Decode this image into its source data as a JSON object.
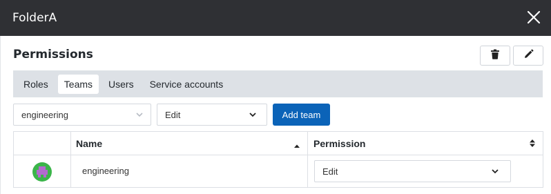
{
  "drawer": {
    "title": "FolderA",
    "close_icon": "close-icon"
  },
  "permissions": {
    "heading": "Permissions",
    "delete_icon": "trash-icon",
    "edit_icon": "pencil-icon"
  },
  "tabs": [
    {
      "label": "Roles",
      "active": false
    },
    {
      "label": "Teams",
      "active": true
    },
    {
      "label": "Users",
      "active": false
    },
    {
      "label": "Service accounts",
      "active": false
    }
  ],
  "add_form": {
    "team_select_value": "engineering",
    "permission_select_value": "Edit",
    "add_button_label": "Add team"
  },
  "table": {
    "columns": [
      {
        "label": ""
      },
      {
        "label": "Name",
        "sort_icon": "sort-asc-icon"
      },
      {
        "label": "Permission",
        "sort_icon": "sort-both-icon"
      }
    ],
    "rows": [
      {
        "avatar": "team-avatar",
        "name": "engineering",
        "permission": "Edit"
      }
    ]
  },
  "colors": {
    "titlebar": "#2f3034",
    "tabs_bg": "#dde1e6",
    "primary_button": "#0b63b8",
    "avatar_green": "#3bb54a",
    "avatar_purple": "#b36ad0"
  }
}
